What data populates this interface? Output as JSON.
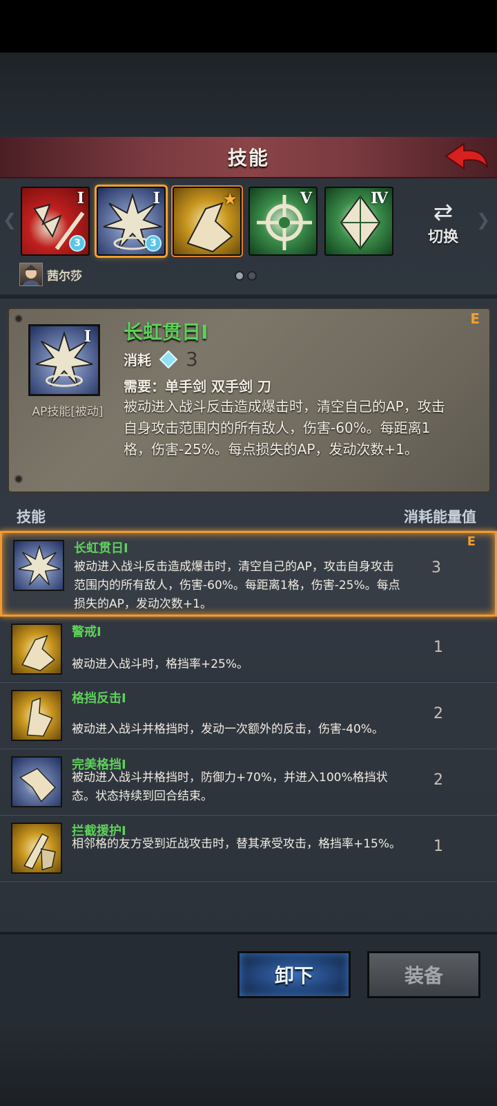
{
  "header": {
    "title": "技能"
  },
  "skill_bar": {
    "slots": [
      {
        "roman": "I",
        "badge": "3",
        "color": "#c0201e"
      },
      {
        "roman": "I",
        "badge": "3",
        "color": "#2a3e78"
      },
      {
        "roman": "",
        "star": "★",
        "color": "#c8961e"
      },
      {
        "roman": "V",
        "color": "#3a8c4a"
      },
      {
        "roman": "Ⅳ",
        "color": "#3a8c4a"
      }
    ],
    "switch_label": "切换",
    "switch_icon": "⇄"
  },
  "hero": {
    "name": "茜尔莎"
  },
  "detail": {
    "rank": "E",
    "roman": "I",
    "type": "AP技能[被动]",
    "name": "长虹贯日I",
    "cost_label": "消耗",
    "cost_value": "3",
    "requirement": "需要：单手剑 双手剑 刀",
    "description": "被动进入战斗反击造成爆击时，清空自己的AP，攻击自身攻击范围内的所有敌人，伤害-60%。每距离1格，伤害-25%。每点损失的AP，发动次数+1。"
  },
  "list_header": {
    "left": "技能",
    "right": "消耗能量值"
  },
  "skills": [
    {
      "name": "长虹贯日I",
      "desc": "被动进入战斗反击造成爆击时，清空自己的AP，攻击自身攻击范围内的所有敌人，伤害-60%。每距离1格，伤害-25%。每点损失的AP，发动次数+1。",
      "cost": "3",
      "rank": "E"
    },
    {
      "name": "警戒I",
      "desc": "被动进入战斗时，格挡率+25%。",
      "cost": "1"
    },
    {
      "name": "格挡反击I",
      "desc": "被动进入战斗并格挡时，发动一次额外的反击，伤害-40%。",
      "cost": "2"
    },
    {
      "name": "完美格挡I",
      "desc": "被动进入战斗并格挡时，防御力+70%，并进入100%格挡状态。状态持续到回合结束。",
      "cost": "2"
    },
    {
      "name": "拦截援护I",
      "desc": "相邻格的友方受到近战攻击时，替其承受攻击，格挡率+15%。",
      "cost": "1"
    }
  ],
  "buttons": {
    "unequip": "卸下",
    "equip": "装备"
  }
}
